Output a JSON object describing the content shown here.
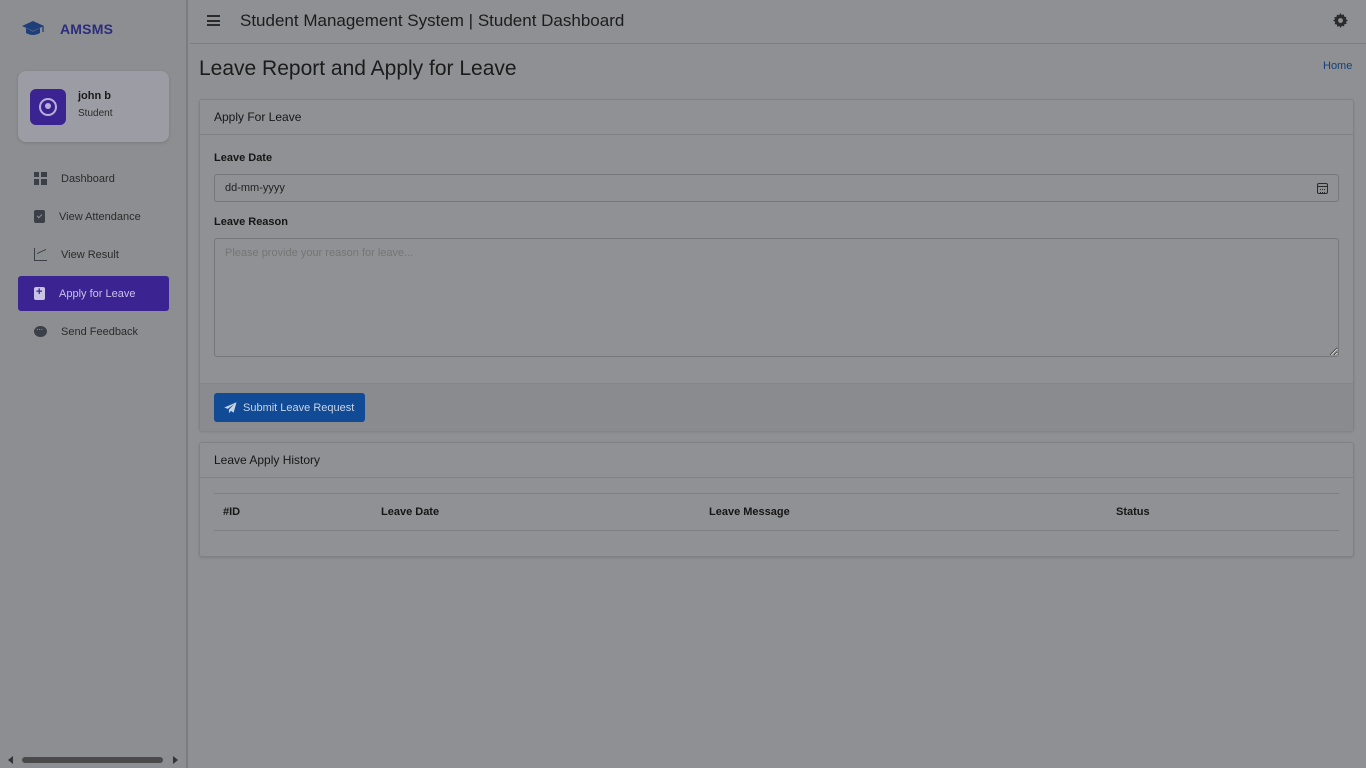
{
  "sidebar": {
    "brand": "AMSMS",
    "user": {
      "name": "john b",
      "role": "Student"
    },
    "items": [
      {
        "label": "Dashboard",
        "icon": "dashboard-icon"
      },
      {
        "label": "View Attendance",
        "icon": "clipboard-check-icon"
      },
      {
        "label": "View Result",
        "icon": "chart-line-icon"
      },
      {
        "label": "Apply for Leave",
        "icon": "clipboard-plus-icon",
        "active": true
      },
      {
        "label": "Send Feedback",
        "icon": "comment-icon"
      }
    ]
  },
  "header": {
    "title": "Student Management System | Student Dashboard"
  },
  "page": {
    "title": "Leave Report and Apply for Leave",
    "breadcrumb": "Home"
  },
  "apply_card": {
    "header": "Apply For Leave",
    "date_label": "Leave Date",
    "date_value": "dd-mm-yyyy",
    "reason_label": "Leave Reason",
    "reason_placeholder": "Please provide your reason for leave...",
    "submit_label": "Submit Leave Request"
  },
  "history_card": {
    "header": "Leave Apply History",
    "columns": [
      "#ID",
      "Leave Date",
      "Leave Message",
      "Status"
    ],
    "rows": []
  },
  "colors": {
    "accent": "#3b2492",
    "button": "#114b95",
    "link": "#143f7a"
  }
}
